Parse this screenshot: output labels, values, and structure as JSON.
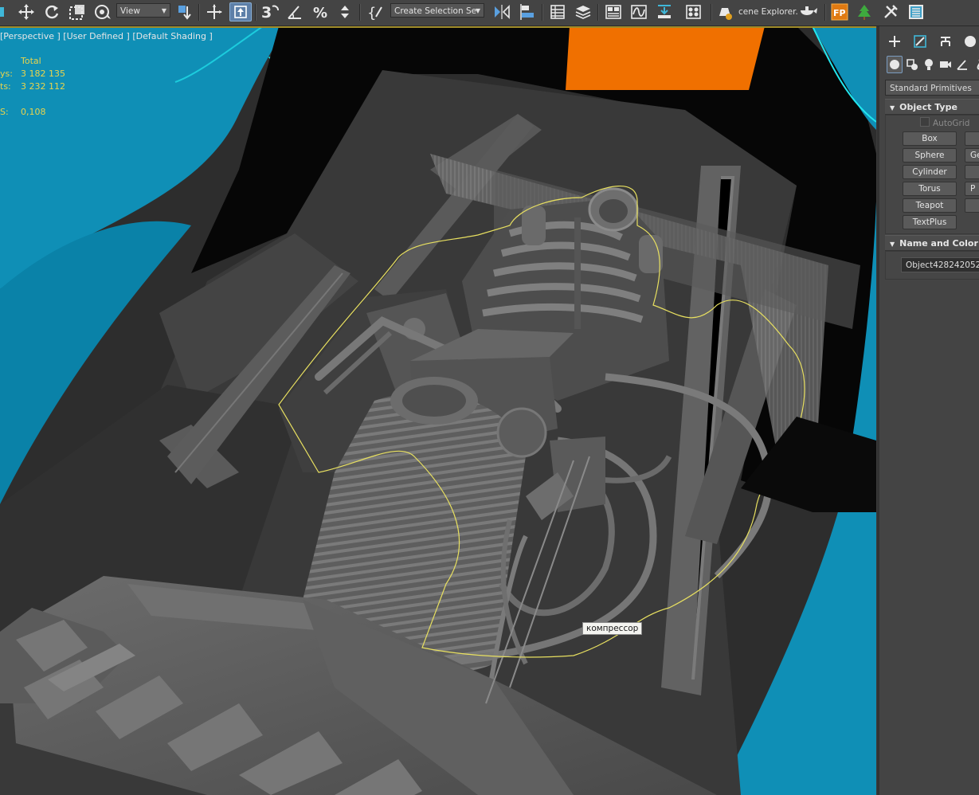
{
  "toolbar": {
    "view_combo": "View",
    "selection_set_combo": "Create Selection Se",
    "scene_explorer_label": "cene Explorer."
  },
  "viewport": {
    "label": "[Perspective ] [User Defined ] [Default Shading ]",
    "stats": {
      "total_header": "Total",
      "polys_label": "ys:",
      "polys_value": "3 182 135",
      "verts_label": "ts:",
      "verts_value": "3 232 112",
      "fps_label": "S:",
      "fps_value": "0,108"
    },
    "tooltip": "компрессор"
  },
  "command_panel": {
    "category": "Standard Primitives",
    "object_type": {
      "title": "Object Type",
      "autogrid": "AutoGrid",
      "buttons_left": [
        "Box",
        "Sphere",
        "Cylinder",
        "Torus",
        "Teapot",
        "TextPlus"
      ],
      "buttons_right_partial": [
        "",
        "Ge",
        "",
        "P",
        "",
        ""
      ]
    },
    "name_and_color": {
      "title": "Name and Color",
      "object_name": "Object428242052"
    }
  },
  "colors": {
    "car_blue": "#0a90b8",
    "car_orange": "#f07000",
    "selection_outline": "#e8e060",
    "highlight_cyan": "#22e6ee",
    "stats_yellow": "#e8d44d"
  }
}
